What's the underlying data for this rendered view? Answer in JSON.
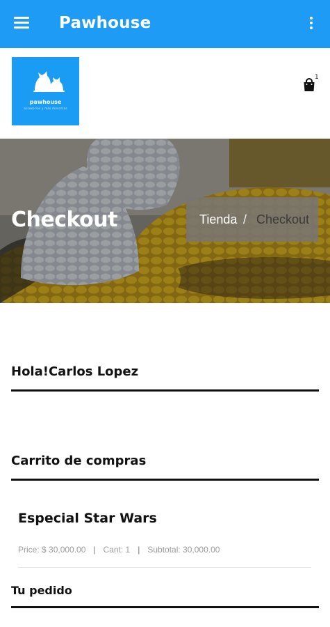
{
  "appbar": {
    "title": "Pawhouse",
    "color": "#1e9bf5"
  },
  "logo": {
    "brand": "pawhouse",
    "tagline": "accesorios y más mascotas"
  },
  "cart": {
    "count": "1",
    "icon": "shopping-bag-icon"
  },
  "hero": {
    "title": "Checkout",
    "breadcrumb": {
      "shop": "Tienda",
      "separator": "/",
      "current": "Checkout"
    }
  },
  "greeting": "Hola!Carlos Lopez",
  "cart_section": {
    "title": "Carrito de compras",
    "item": {
      "name": "Especial Star Wars",
      "price": "Price: $ 30,000.00",
      "qty": "Cant: 1",
      "subtotal": "Subtotal: 30,000.00"
    }
  },
  "order_title": "Tu pedido"
}
